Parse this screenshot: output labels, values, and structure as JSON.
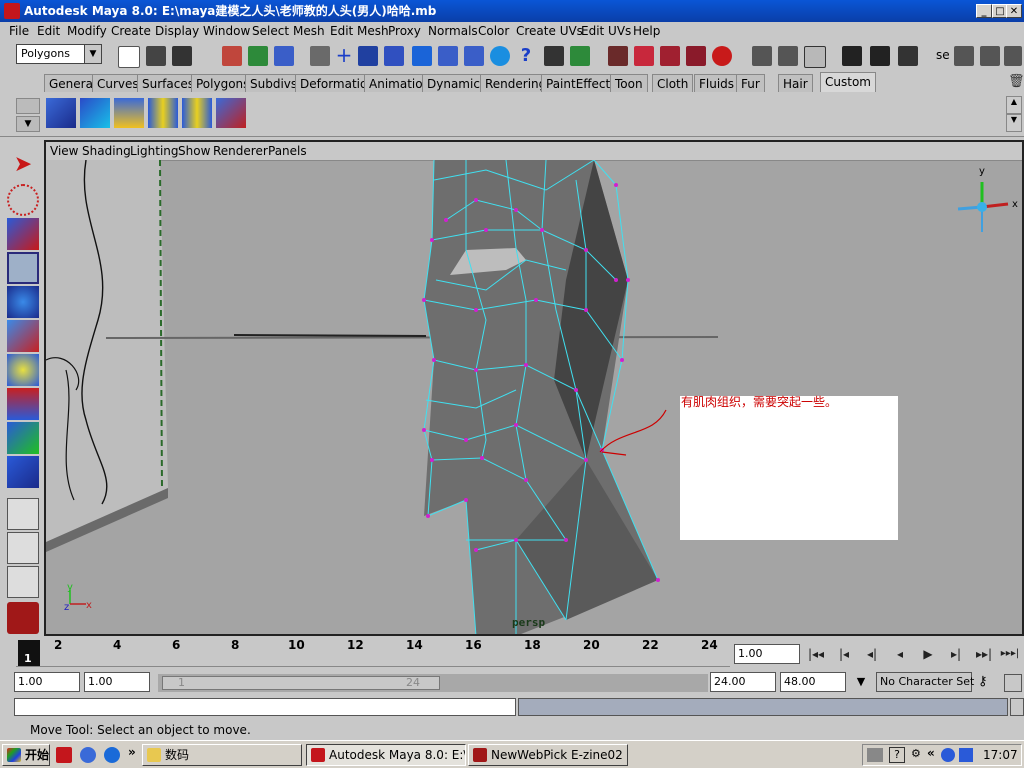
{
  "window": {
    "title": "Autodesk Maya 8.0: E:\\maya建模之人头\\老师教的人头(男人)哈哈.mb"
  },
  "menu": [
    "File",
    "Edit",
    "Modify",
    "Create",
    "Display",
    "Window",
    "Select",
    "Mesh",
    "Edit Mesh",
    "Proxy",
    "Normals",
    "Color",
    "Create UVs",
    "Edit UVs",
    "Help"
  ],
  "status_line": {
    "mode": "Polygons",
    "trailing_text": "se"
  },
  "shelf_tabs": [
    "General",
    "Curves",
    "Surfaces",
    "Polygons",
    "Subdivs",
    "Deformation",
    "Animation",
    "Dynamics",
    "Rendering",
    "PaintEffects",
    "Toon",
    "Cloth",
    "Fluids",
    "Fur",
    "Hair",
    "Custom"
  ],
  "active_shelf_tab": "Custom",
  "panel_menu": [
    "View",
    "Shading",
    "Lighting",
    "Show",
    "Renderer",
    "Panels"
  ],
  "viewport": {
    "camera_label": "persp",
    "annotation": "有肌肉组织，需要突起一些。",
    "view_cube_axes": {
      "y": "y",
      "x": "x"
    },
    "origin_axes": {
      "y": "y",
      "z": "z",
      "x": "x"
    }
  },
  "time_slider": {
    "ticks": [
      "2",
      "4",
      "6",
      "8",
      "10",
      "12",
      "14",
      "16",
      "18",
      "20",
      "22",
      "24"
    ],
    "current_frame": "1",
    "current_time_field": "1.00"
  },
  "playback_buttons": [
    "|◂◂",
    "|◂",
    "◂|",
    "◂",
    "▶",
    "▸|",
    "▸▸|",
    "▸▸▸|"
  ],
  "range": {
    "start_time": "1.00",
    "playback_start": "1.00",
    "slider_start": "1",
    "slider_end": "24",
    "playback_end": "24.00",
    "end_time": "48.00",
    "character_set": "No Character Set"
  },
  "help_line": "Move Tool: Select an object to move.",
  "taskbar": {
    "start": "开始",
    "items": [
      {
        "label": "数码"
      },
      {
        "label": "Autodesk Maya 8.0: E:\\..."
      },
      {
        "label": "NewWebPick E-zine02"
      }
    ],
    "clock": "17:07"
  },
  "colors": {
    "title_bar": "#0a46c4",
    "mesh_wire": "#40e0f0",
    "vertex": "#d020d0",
    "annotation_text": "#cc0000"
  }
}
